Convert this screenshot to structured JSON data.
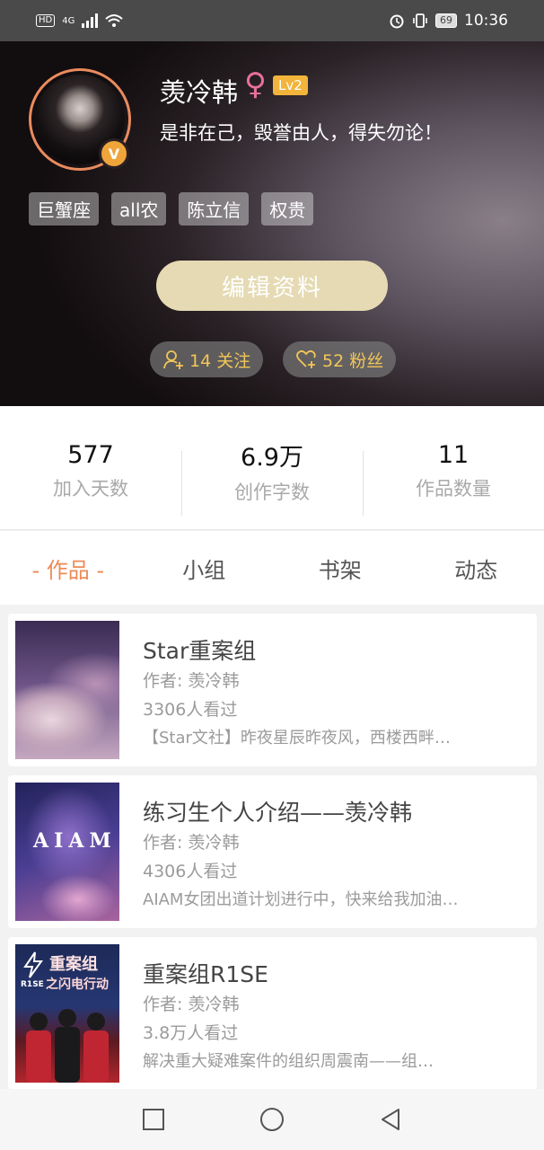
{
  "status_bar": {
    "hd": "HD",
    "network": "4G",
    "battery": "69",
    "time": "10:36"
  },
  "profile": {
    "username": "羡冷韩",
    "gender_symbol": "♀",
    "level": "Lv2",
    "verified_badge": "V",
    "bio": "是非在己，毁誉由人，得失勿论！",
    "tags": [
      "巨蟹座",
      "all农",
      "陈立信",
      "权贵"
    ],
    "edit_button": "编辑资料",
    "following": "14 关注",
    "fans": "52 粉丝"
  },
  "stats": [
    {
      "value": "577",
      "label": "加入天数"
    },
    {
      "value": "6.9万",
      "label": "创作字数"
    },
    {
      "value": "11",
      "label": "作品数量"
    }
  ],
  "tabs": [
    "- 作品 -",
    "小组",
    "书架",
    "动态"
  ],
  "works": [
    {
      "title": "Star重案组",
      "author": "作者: 羡冷韩",
      "views": "3306人看过",
      "desc": "【Star文社】昨夜星辰昨夜风，西楼西畔…",
      "cover_text": ""
    },
    {
      "title": "练习生个人介绍——羡冷韩",
      "author": "作者: 羡冷韩",
      "views": "4306人看过",
      "desc": "AIAM女团出道计划进行中，快来给我加油…",
      "cover_text": "AIAM"
    },
    {
      "title": "重案组R1SE",
      "author": "作者: 羡冷韩",
      "views": "3.8万人看过",
      "desc": "解决重大疑难案件的组织周震南——组…",
      "cover_text": "重案组",
      "cover_sub": "之闪电行动",
      "cover_logo": "R1SE"
    }
  ],
  "colors": {
    "accent": "#ee8a55",
    "gold": "#f2c657",
    "level": "#f2b43a",
    "edit_button": "#e5dab3"
  },
  "icons": [
    "person-add-icon",
    "heart-add-icon",
    "square-nav-icon",
    "circle-nav-icon",
    "back-triangle-icon"
  ]
}
